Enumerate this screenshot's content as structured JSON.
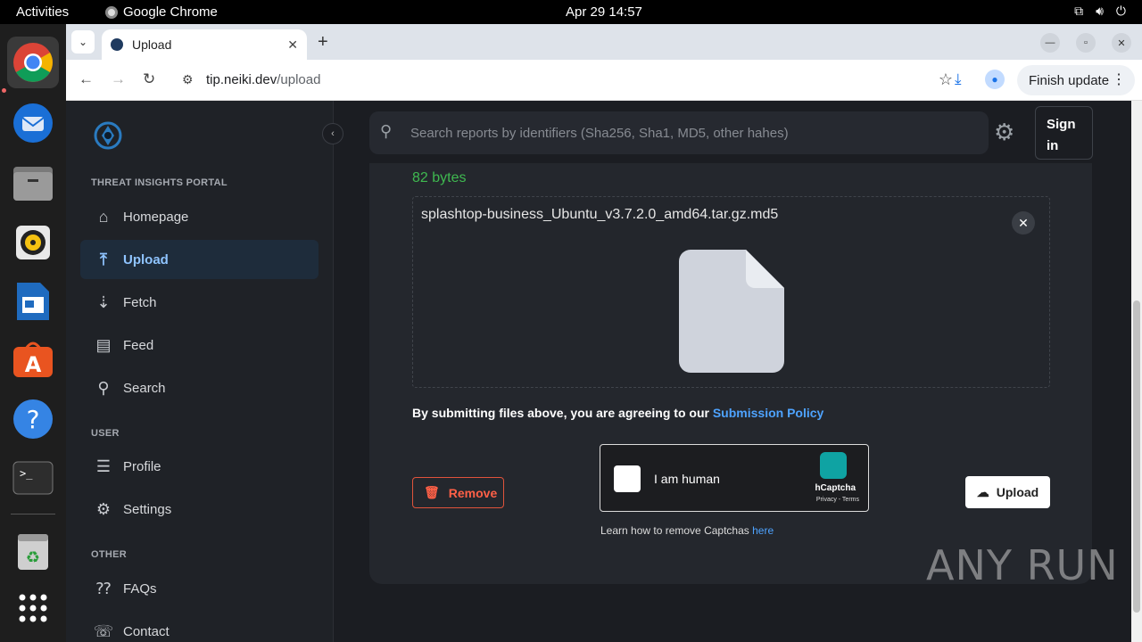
{
  "topbar": {
    "activities": "Activities",
    "app_name": "Google Chrome",
    "clock": "Apr 29  14:57"
  },
  "dock": {
    "items": [
      "chrome-icon",
      "thunderbird-icon",
      "files-icon",
      "rhythmbox-icon",
      "writer-icon",
      "software-icon",
      "help-icon",
      "terminal-icon",
      "trash-icon",
      "apps-grid-icon"
    ]
  },
  "browser": {
    "tab_title": "Upload",
    "url_host": "tip.neiki.dev",
    "url_path": "/upload",
    "finish_update": "Finish update"
  },
  "sidebar": {
    "section_portal": "THREAT INSIGHTS PORTAL",
    "section_user": "USER",
    "section_other": "OTHER",
    "items": [
      {
        "label": "Homepage",
        "icon": "home-icon"
      },
      {
        "label": "Upload",
        "icon": "upload-icon"
      },
      {
        "label": "Fetch",
        "icon": "fetch-icon"
      },
      {
        "label": "Feed",
        "icon": "feed-icon"
      },
      {
        "label": "Search",
        "icon": "search-icon"
      },
      {
        "label": "Profile",
        "icon": "profile-icon"
      },
      {
        "label": "Settings",
        "icon": "gear-icon"
      },
      {
        "label": "FAQs",
        "icon": "faq-icon"
      },
      {
        "label": "Contact",
        "icon": "contact-icon"
      }
    ]
  },
  "header": {
    "search_placeholder": "Search reports by identifiers (Sha256, Sha1, MD5, other hahes)",
    "sign_in": "Sign in"
  },
  "upload": {
    "size": "82 bytes",
    "file_name": "splashtop-business_Ubuntu_v3.7.2.0_amd64.tar.gz.md5",
    "policy_text": "By submitting files above, you are agreeing to our",
    "policy_link": "Submission Policy",
    "remove_label": "Remove",
    "upload_label": "Upload",
    "captcha_label": "I am human",
    "captcha_brand": "hCaptcha",
    "captcha_links": "Privacy - Terms",
    "learn_text": "Learn how to remove Captchas",
    "learn_link": "here"
  },
  "watermark": "ANY RUN",
  "colors": {
    "accent": "#4ea3ff",
    "success": "#3fb950",
    "danger": "#ff6047"
  }
}
